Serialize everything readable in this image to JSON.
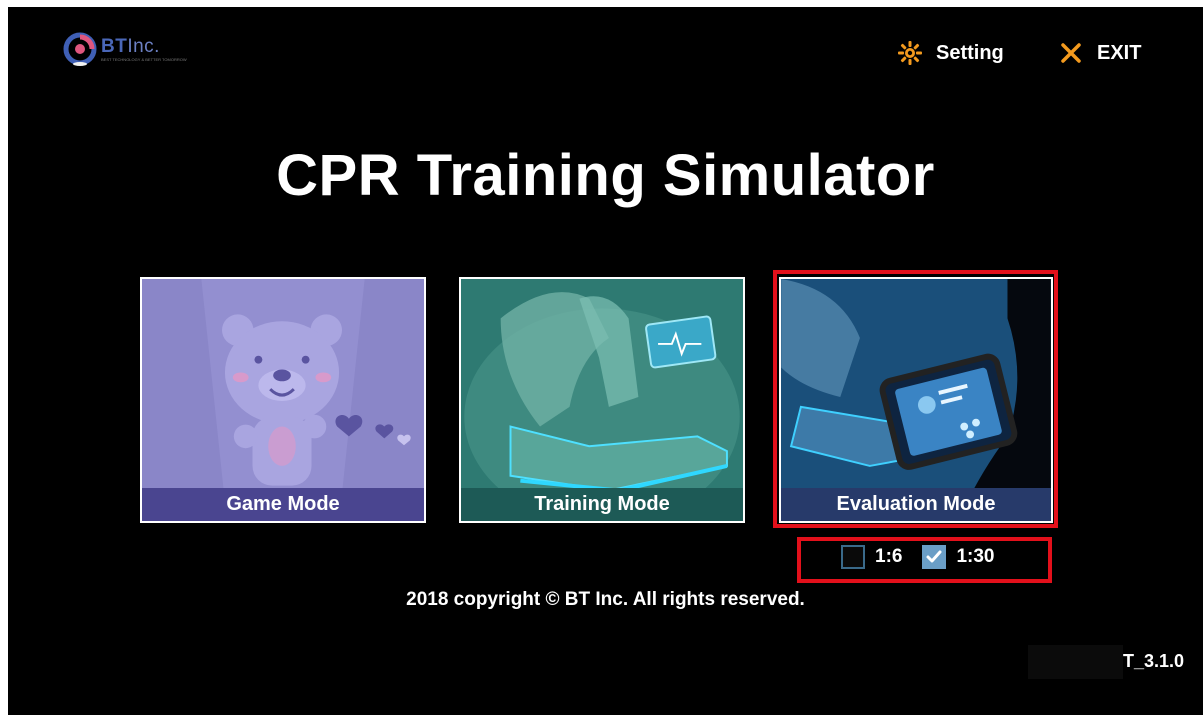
{
  "brand": {
    "logo_main": "BT",
    "logo_inc": "Inc.",
    "logo_sub": "BEST TECHNOLOGY & BETTER TOMORROW"
  },
  "header": {
    "setting_label": "Setting",
    "exit_label": "EXIT",
    "setting_icon": "gear-icon",
    "exit_icon": "close-icon",
    "accent_color": "#f39a1e"
  },
  "title": "CPR Training Simulator",
  "modes": [
    {
      "label": "Game Mode",
      "icon": "bear-illustration"
    },
    {
      "label": "Training Mode",
      "icon": "cpr-training-illustration"
    },
    {
      "label": "Evaluation Mode",
      "icon": "cpr-evaluation-illustration"
    }
  ],
  "ratio_options": [
    {
      "label": "1:6",
      "checked": false
    },
    {
      "label": "1:30",
      "checked": true
    }
  ],
  "highlight_color": "#e3101b",
  "copyright": "2018 copyright © BT Inc. All rights reserved.",
  "version": "T_3.1.0"
}
